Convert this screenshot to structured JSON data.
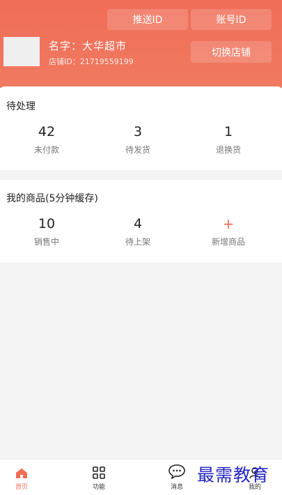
{
  "header": {
    "push_id_label": "推送ID",
    "account_id_label": "账号ID",
    "store_name": "名字：大华超市",
    "store_id": "店铺ID：21719559199",
    "switch_store_label": "切换店铺"
  },
  "pending": {
    "title": "待处理",
    "stats": [
      {
        "value": "42",
        "label": "未付款"
      },
      {
        "value": "3",
        "label": "待发货"
      },
      {
        "value": "1",
        "label": "退换货"
      }
    ]
  },
  "goods": {
    "title": "我的商品(5分钟缓存)",
    "stats": [
      {
        "value": "10",
        "label": "销售中"
      },
      {
        "value": "4",
        "label": "待上架"
      },
      {
        "value": "+",
        "label": "新增商品"
      }
    ]
  },
  "tabbar": {
    "items": [
      {
        "label": "首页",
        "icon": "home-icon"
      },
      {
        "label": "功能",
        "icon": "grid-icon"
      },
      {
        "label": "消息",
        "icon": "chat-icon"
      },
      {
        "label": "我的",
        "icon": "user-icon"
      }
    ]
  },
  "watermark": "最需教育",
  "colors": {
    "accent": "#f06d58"
  }
}
